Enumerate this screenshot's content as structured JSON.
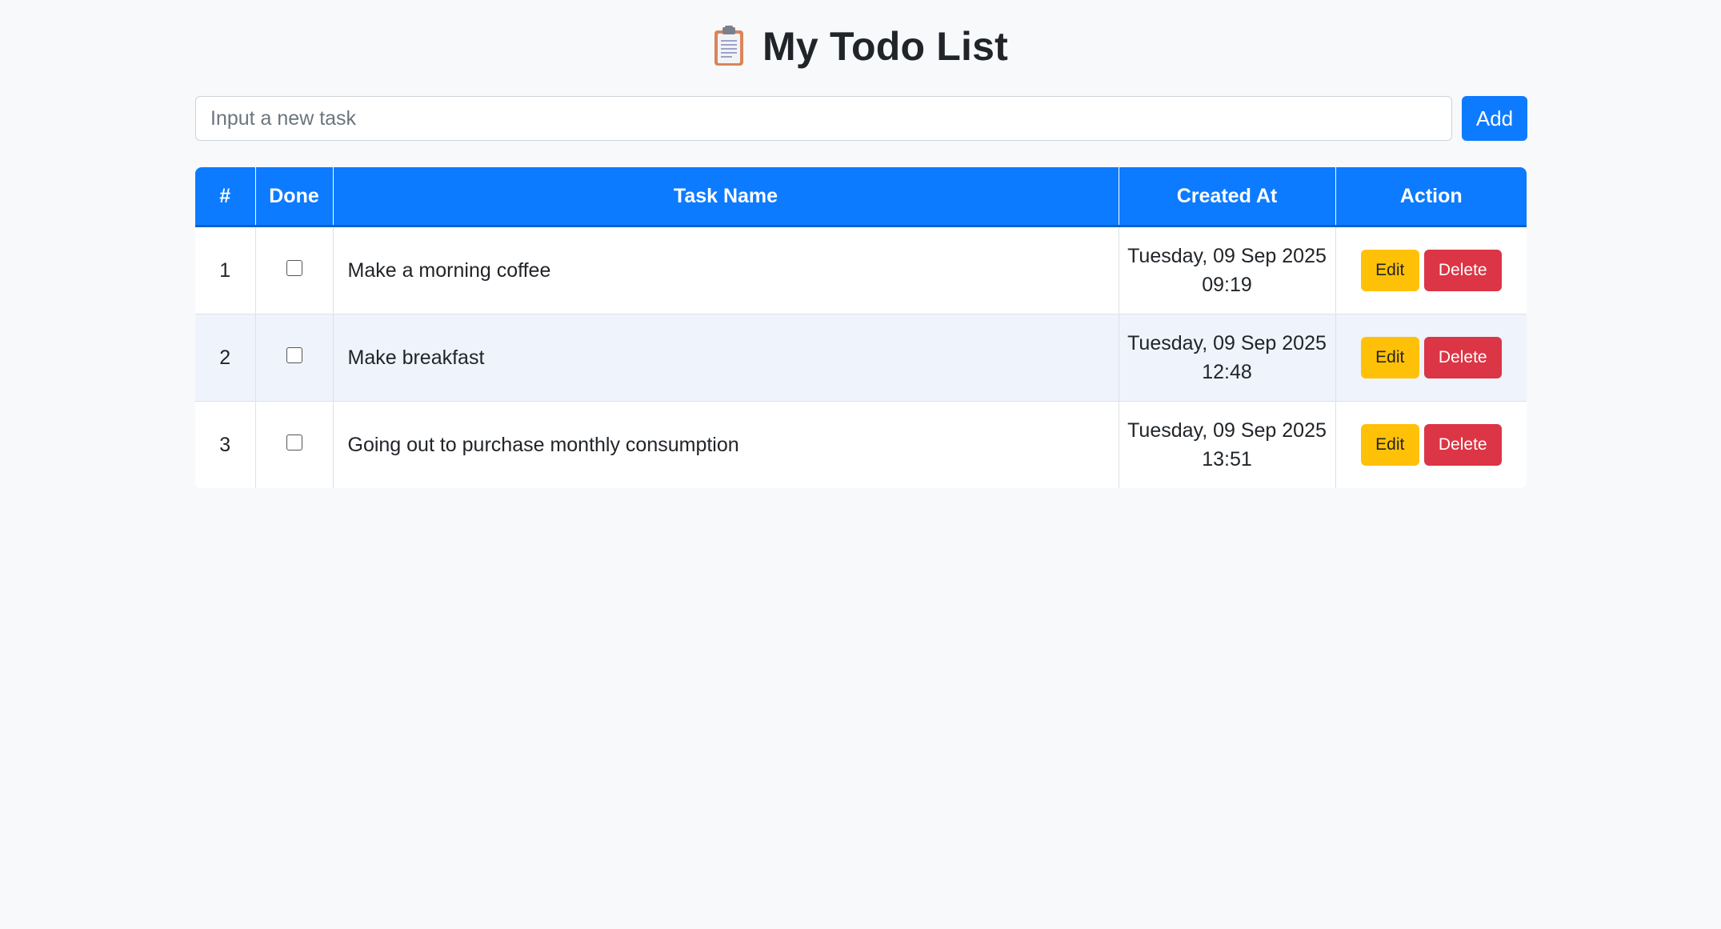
{
  "header": {
    "icon": "clipboard-icon",
    "title": "My Todo List"
  },
  "add_form": {
    "input_value": "",
    "input_placeholder": "Input a new task",
    "add_label": "Add"
  },
  "table": {
    "columns": [
      "#",
      "Done",
      "Task Name",
      "Created At",
      "Action"
    ],
    "rows": [
      {
        "index": "1",
        "done": false,
        "task": "Make a morning coffee",
        "created_date": "Tuesday, 09 Sep 2025",
        "created_time": "09:19",
        "edit_label": "Edit",
        "delete_label": "Delete"
      },
      {
        "index": "2",
        "done": false,
        "task": "Make breakfast",
        "created_date": "Tuesday, 09 Sep 2025",
        "created_time": "12:48",
        "edit_label": "Edit",
        "delete_label": "Delete"
      },
      {
        "index": "3",
        "done": false,
        "task": "Going out to purchase monthly consumption",
        "created_date": "Tuesday, 09 Sep 2025",
        "created_time": "13:51",
        "edit_label": "Edit",
        "delete_label": "Delete"
      }
    ]
  },
  "colors": {
    "primary": "#0d7bff",
    "warning": "#ffc107",
    "danger": "#dc3545",
    "background": "#f8f9fa",
    "striped_row": "#eff3fb"
  }
}
